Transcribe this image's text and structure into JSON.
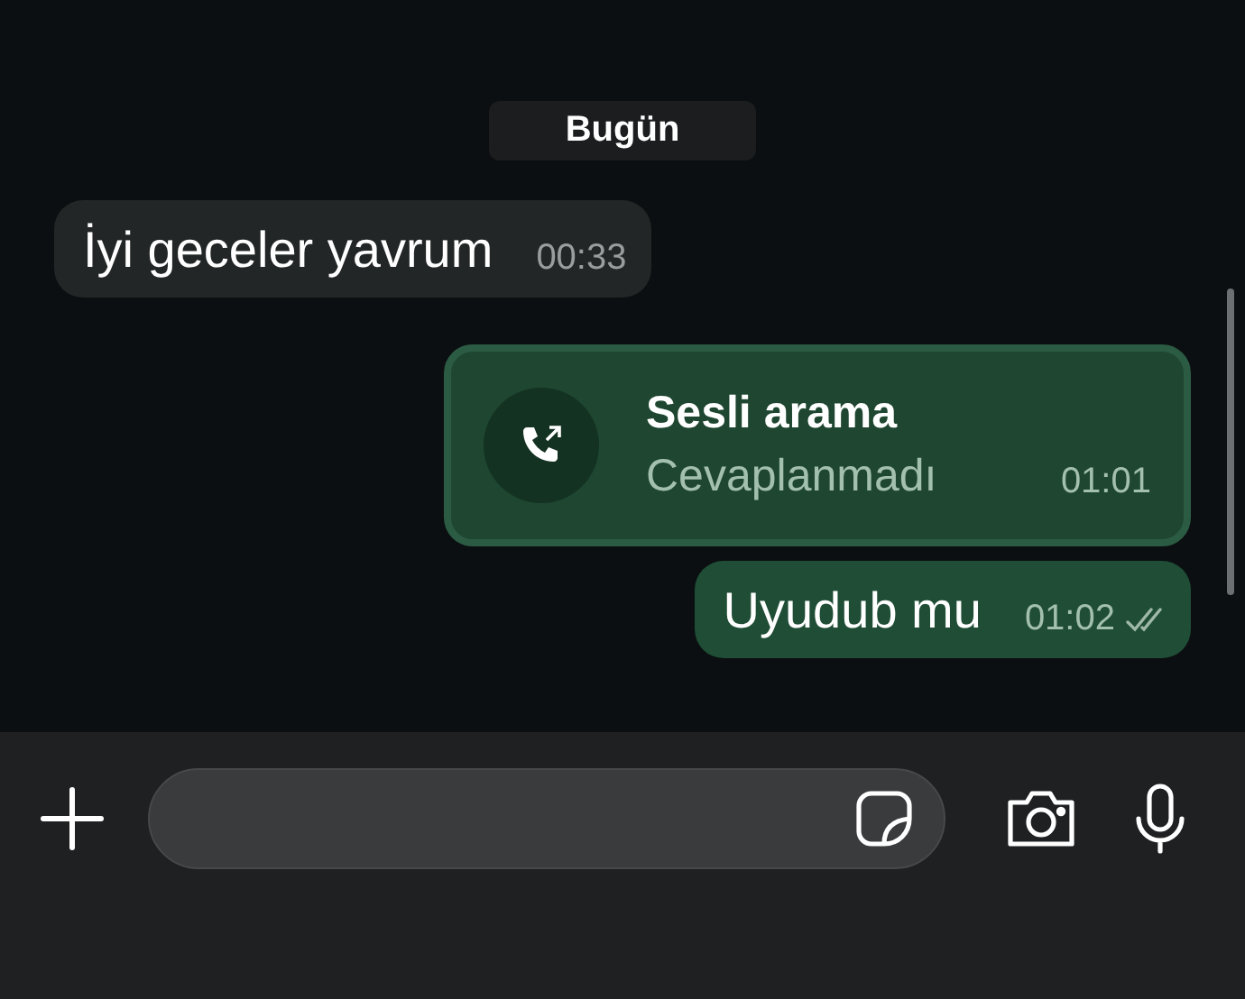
{
  "day_label": "Bugün",
  "messages": [
    {
      "kind": "text",
      "outgoing": false,
      "text": "İyi geceler yavrum",
      "time": "00:33"
    },
    {
      "kind": "call",
      "outgoing": true,
      "title": "Sesli arama",
      "subtitle": "Cevaplanmadı",
      "time": "01:01"
    },
    {
      "kind": "text",
      "outgoing": true,
      "text": "Uyudub mu",
      "time": "01:02",
      "read": false
    }
  ]
}
